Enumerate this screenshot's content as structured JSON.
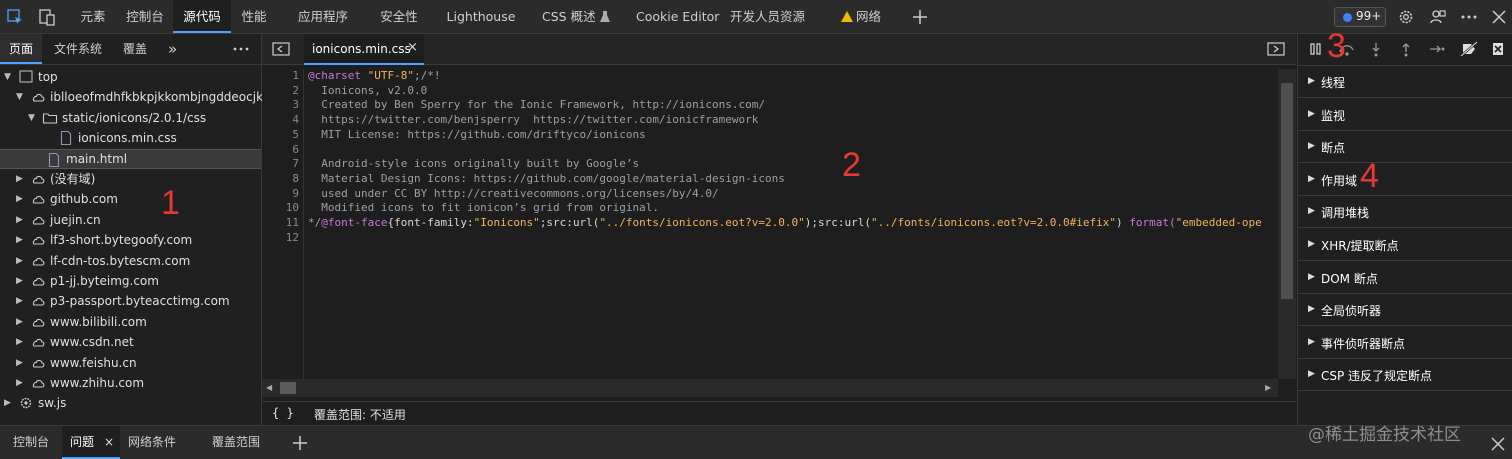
{
  "top_tabs": [
    "元素",
    "控制台",
    "源代码",
    "性能",
    "应用程序",
    "安全性",
    "Lighthouse",
    "CSS 概述",
    "Cookie Editor",
    "开发人员资源",
    "网络"
  ],
  "issues_count": "99+",
  "left_tabs": [
    "页面",
    "文件系统",
    "覆盖"
  ],
  "tree": [
    {
      "label": "top",
      "kind": "frame"
    },
    {
      "label": "iblloeofmdhfkbkpjkkombjngddeocjk",
      "kind": "cloud"
    },
    {
      "label": "static/ionicons/2.0.1/css",
      "kind": "folder"
    },
    {
      "label": "ionicons.min.css",
      "kind": "file"
    },
    {
      "label": "main.html",
      "kind": "file"
    },
    {
      "label": "(没有域)",
      "kind": "cloud"
    },
    {
      "label": "github.com",
      "kind": "cloud"
    },
    {
      "label": "juejin.cn",
      "kind": "cloud"
    },
    {
      "label": "lf3-short.bytegoofy.com",
      "kind": "cloud"
    },
    {
      "label": "lf-cdn-tos.bytescm.com",
      "kind": "cloud"
    },
    {
      "label": "p1-jj.byteimg.com",
      "kind": "cloud"
    },
    {
      "label": "p3-passport.byteacctimg.com",
      "kind": "cloud"
    },
    {
      "label": "www.bilibili.com",
      "kind": "cloud"
    },
    {
      "label": "www.csdn.net",
      "kind": "cloud"
    },
    {
      "label": "www.feishu.cn",
      "kind": "cloud"
    },
    {
      "label": "www.zhihu.com",
      "kind": "cloud"
    },
    {
      "label": "sw.js",
      "kind": "gear"
    }
  ],
  "editor": {
    "open_file": "ionicons.min.css",
    "line_numbers": [
      "1",
      "2",
      "3",
      "4",
      "5",
      "6",
      "7",
      "8",
      "9",
      "10",
      "11",
      "12"
    ],
    "lines": [
      [
        {
          "t": "@charset",
          "c": "kw"
        },
        {
          "t": " ",
          "c": ""
        },
        {
          "t": "\"UTF-8\"",
          "c": "str"
        },
        {
          "t": ";/*!",
          "c": ""
        }
      ],
      [
        {
          "t": "  Ionicons, v2.0.0",
          "c": ""
        }
      ],
      [
        {
          "t": "  Created by Ben Sperry for the Ionic Framework, http://ionicons.com/",
          "c": ""
        }
      ],
      [
        {
          "t": "  https://twitter.com/benjsperry  https://twitter.com/ionicframework",
          "c": ""
        }
      ],
      [
        {
          "t": "  MIT License: https://github.com/driftyco/ionicons",
          "c": ""
        }
      ],
      [
        {
          "t": "",
          "c": ""
        }
      ],
      [
        {
          "t": "  Android-style icons originally built by Google’s",
          "c": ""
        }
      ],
      [
        {
          "t": "  Material Design Icons: https://github.com/google/material-design-icons",
          "c": ""
        }
      ],
      [
        {
          "t": "  used under CC BY http://creativecommons.org/licenses/by/4.0/",
          "c": ""
        }
      ],
      [
        {
          "t": "  Modified icons to fit ionicon’s grid from original.",
          "c": ""
        }
      ],
      [
        {
          "t": "*/",
          "c": ""
        },
        {
          "t": "@font-face",
          "c": "kw"
        },
        {
          "t": "{font-family:",
          "c": "prop"
        },
        {
          "t": "\"Ionicons\"",
          "c": "str"
        },
        {
          "t": ";src:",
          "c": "prop"
        },
        {
          "t": "url(",
          "c": "prop"
        },
        {
          "t": "\"../fonts/ionicons.eot?v=2.0.0\"",
          "c": "str"
        },
        {
          "t": ");src:",
          "c": "prop"
        },
        {
          "t": "url(",
          "c": "prop"
        },
        {
          "t": "\"../fonts/ionicons.eot?v=2.0.0#iefix\"",
          "c": "str"
        },
        {
          "t": ") ",
          "c": "prop"
        },
        {
          "t": "format(",
          "c": "kw"
        },
        {
          "t": "\"embedded-ope",
          "c": "str"
        }
      ],
      [
        {
          "t": "",
          "c": ""
        }
      ]
    ],
    "status_braces": "{ }",
    "coverage": "覆盖范围: 不适用"
  },
  "debugger_sections": [
    "线程",
    "监视",
    "断点",
    "作用域",
    "调用堆栈",
    "XHR/提取断点",
    "DOM 断点",
    "全局侦听器",
    "事件侦听器断点",
    "CSP 违反了规定断点"
  ],
  "drawer_tabs": [
    "控制台",
    "问题",
    "网络条件",
    "覆盖范围"
  ],
  "annotations": [
    "1",
    "2",
    "3",
    "4"
  ],
  "watermark": "@稀土掘金技术社区",
  "colors": {
    "accent": "#4fa3ff",
    "annotation": "#e53935",
    "keyword": "#c678dd",
    "string": "#f0b35a"
  }
}
